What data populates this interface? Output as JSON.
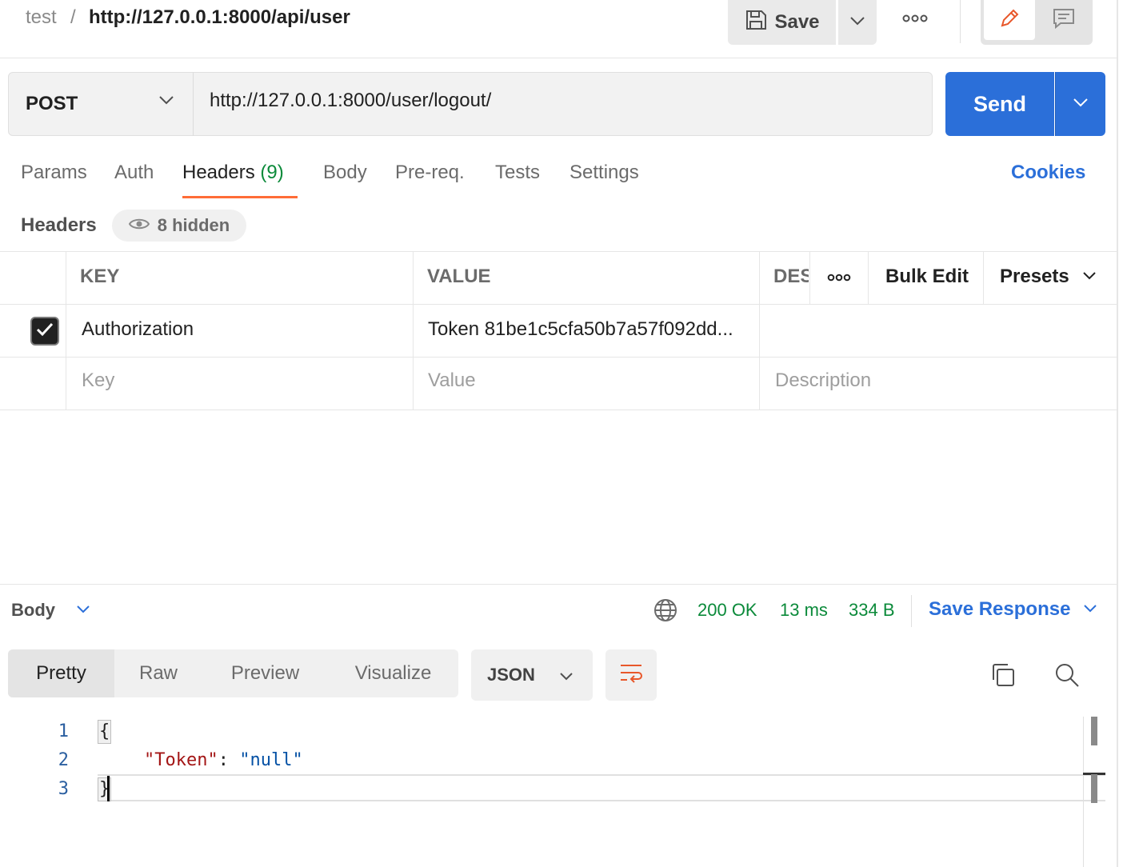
{
  "breadcrumb": {
    "parent": "test",
    "separator": "/",
    "current": "http://127.0.0.1:8000/api/user"
  },
  "toolbar": {
    "save_label": "Save"
  },
  "request": {
    "method": "POST",
    "url": "http://127.0.0.1:8000/user/logout/",
    "send_label": "Send"
  },
  "tabs": {
    "params": "Params",
    "auth": "Auth",
    "headers": "Headers",
    "headers_count": "(9)",
    "body": "Body",
    "prereq": "Pre-req.",
    "tests": "Tests",
    "settings": "Settings",
    "cookies": "Cookies"
  },
  "headers_section": {
    "title": "Headers",
    "hidden": "8 hidden",
    "columns": {
      "key": "KEY",
      "value": "VALUE",
      "description": "DES"
    },
    "bulk_edit": "Bulk Edit",
    "presets": "Presets",
    "rows": [
      {
        "key": "Authorization",
        "value": "Token 81be1c5cfa50b7a57f092dd...",
        "checked": true
      }
    ],
    "placeholders": {
      "key": "Key",
      "value": "Value",
      "description": "Description"
    }
  },
  "response": {
    "body_label": "Body",
    "status": "200 OK",
    "time": "13 ms",
    "size": "334 B",
    "save_response": "Save Response",
    "views": [
      "Pretty",
      "Raw",
      "Preview",
      "Visualize"
    ],
    "active_view": "Pretty",
    "format": "JSON",
    "code_lines": [
      {
        "num": "1",
        "text": "{"
      },
      {
        "num": "2",
        "key": "\"Token\"",
        "colon": ": ",
        "value": "\"null\""
      },
      {
        "num": "3",
        "text": "}"
      }
    ]
  },
  "colors": {
    "accent": "#2b6fd9",
    "tab_underline": "#ff6c37",
    "success": "#0b8a3a"
  },
  "icons": [
    "save-icon",
    "chevron-down-icon",
    "more-icon",
    "pencil-icon",
    "comment-icon",
    "eye-icon",
    "globe-icon",
    "wrap-icon",
    "copy-icon",
    "search-icon",
    "checkmark-icon"
  ]
}
